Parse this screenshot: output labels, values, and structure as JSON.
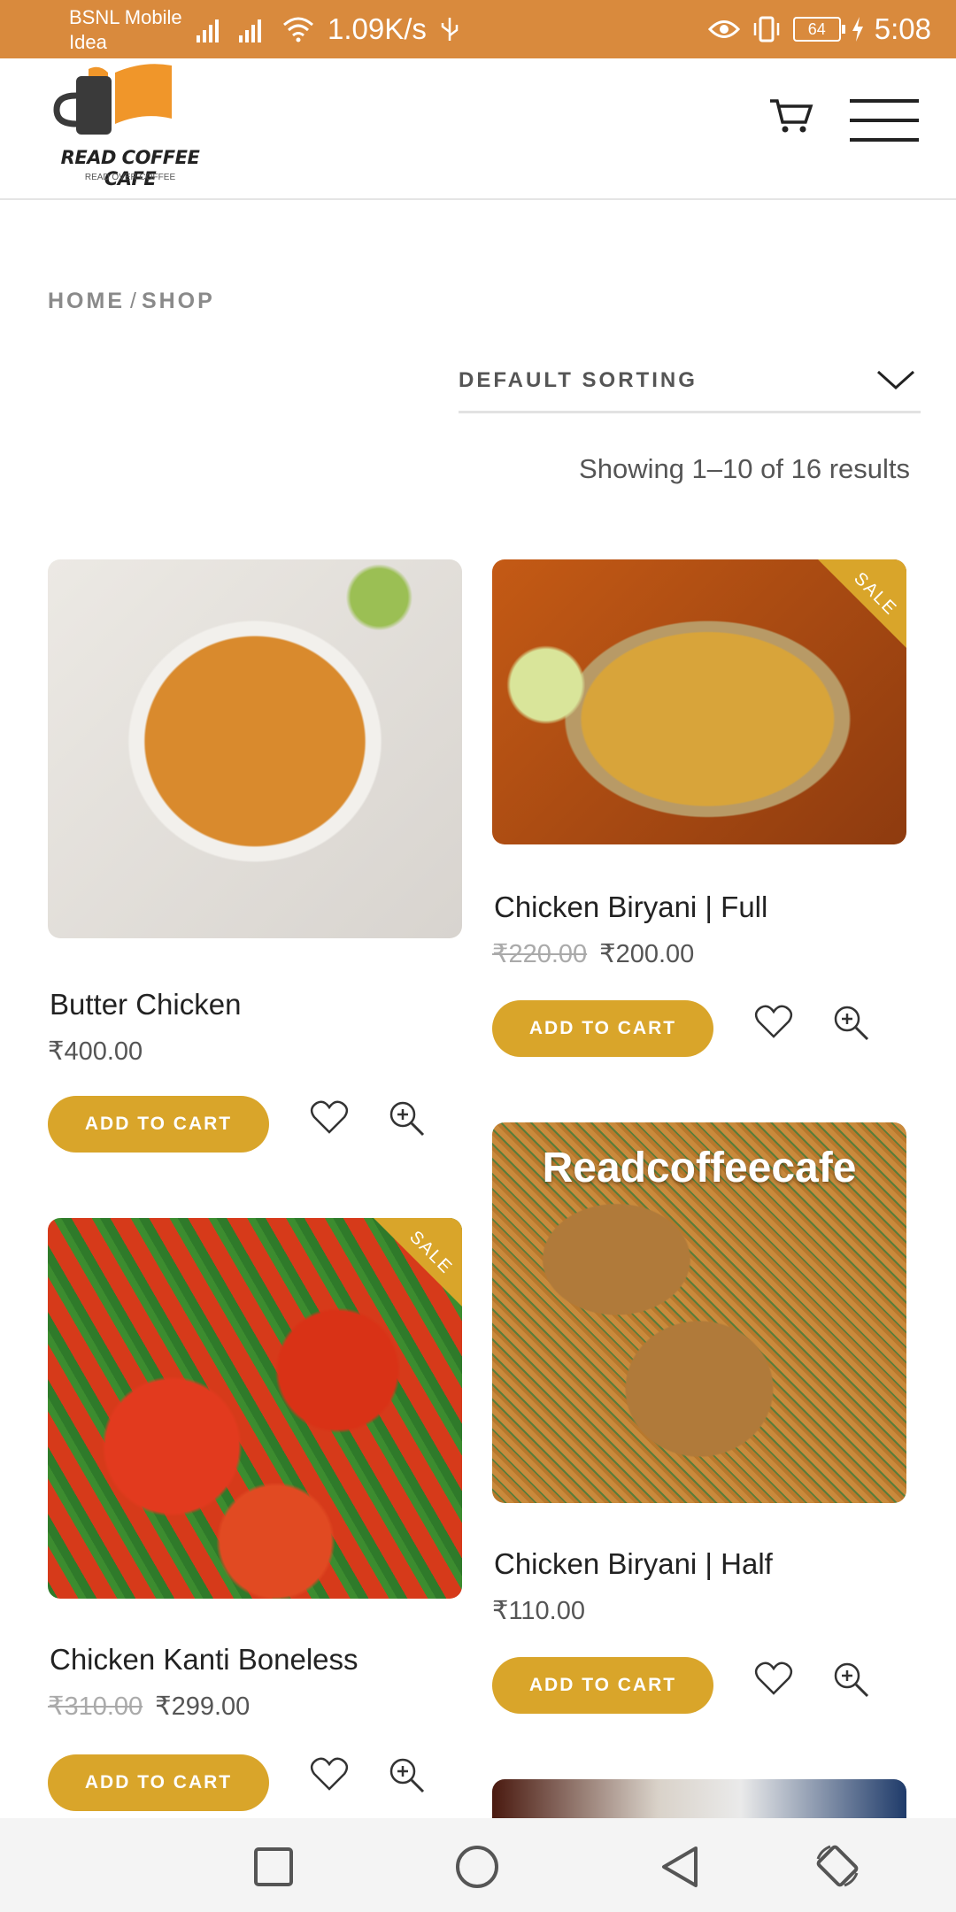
{
  "status_bar": {
    "carrier_line1": "BSNL Mobile",
    "carrier_line2": "Idea",
    "speed": "1.09K/s",
    "battery": "64",
    "time": "5:08",
    "color": "#d98a3d"
  },
  "header": {
    "logo_title": "READ COFFEE CAFE",
    "logo_tagline": "READ OVER COFFEE"
  },
  "breadcrumb": {
    "home": "HOME",
    "separator": "/",
    "current": "SHOP"
  },
  "sorting": {
    "selected": "DEFAULT SORTING"
  },
  "results_text": "Showing 1–10 of 16 results",
  "accent_color": "#d9a52a",
  "products": [
    {
      "title": "Butter Chicken",
      "price": "₹400.00",
      "add_label": "ADD TO CART"
    },
    {
      "title": "Chicken Biryani | Full",
      "old_price": "₹220.00",
      "price": "₹200.00",
      "badge": "SALE",
      "add_label": "ADD TO CART"
    },
    {
      "title": "Chicken Kanti Boneless",
      "old_price": "₹310.00",
      "price": "₹299.00",
      "badge": "SALE",
      "add_label": "ADD TO CART"
    },
    {
      "title": "Chicken Biryani | Half",
      "price": "₹110.00",
      "image_watermark": "Readcoffeecafe",
      "add_label": "ADD TO CART"
    }
  ]
}
